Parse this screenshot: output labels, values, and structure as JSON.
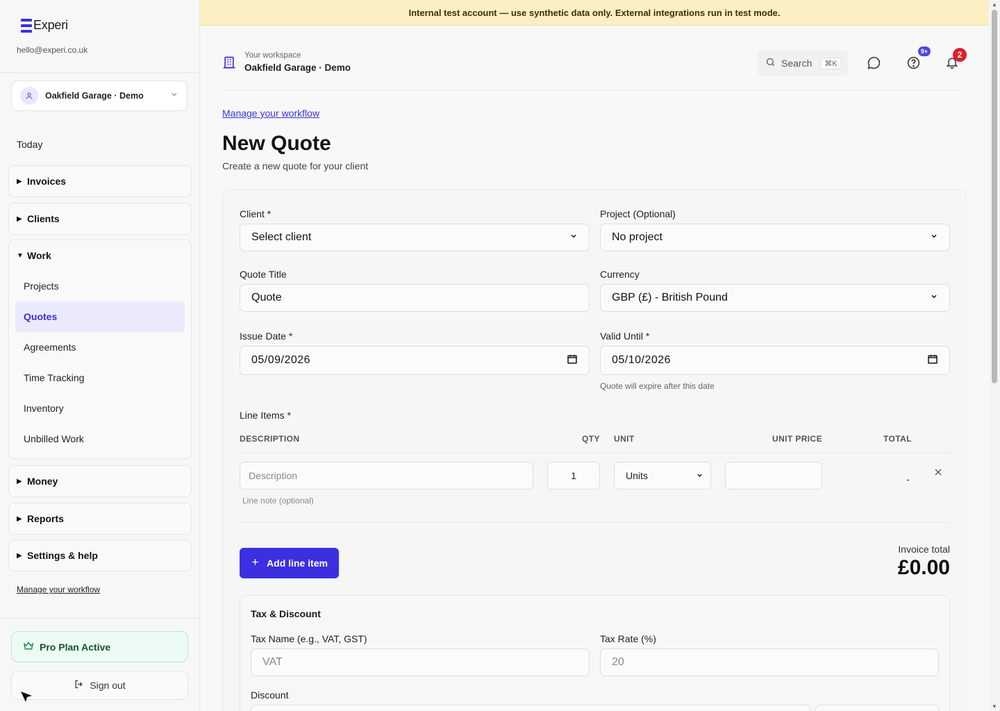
{
  "brand": {
    "name": "Experi",
    "email": "hello@experi.co.uk"
  },
  "workspace_select": {
    "value": "Oakfield Garage · Demo"
  },
  "sidebar": {
    "today": "Today",
    "groups": [
      {
        "label": "Invoices",
        "expanded": false
      },
      {
        "label": "Clients",
        "expanded": false
      },
      {
        "label": "Work",
        "expanded": true,
        "items": [
          "Projects",
          "Quotes",
          "Agreements",
          "Time Tracking",
          "Inventory",
          "Unbilled Work"
        ],
        "active": "Quotes"
      },
      {
        "label": "Money",
        "expanded": false
      },
      {
        "label": "Reports",
        "expanded": false
      },
      {
        "label": "Settings & help",
        "expanded": false
      }
    ],
    "manage_link": "Manage your workflow",
    "pro_plan": "Pro Plan Active",
    "sign_out": "Sign out"
  },
  "banner": {
    "text": "Internal test account — use synthetic data only. External integrations run in test mode."
  },
  "header": {
    "kicker": "Your workspace",
    "workspace_name": "Oakfield Garage · Demo",
    "search_label": "Search",
    "search_shortcut": "⌘K",
    "help_badge": "9+",
    "notifications_badge": "2"
  },
  "main": {
    "manage_link": "Manage your workflow",
    "title": "New Quote",
    "subtitle": "Create a new quote for your client",
    "form": {
      "client_label": "Client *",
      "client_value": "Select client",
      "project_label": "Project (Optional)",
      "project_value": "No project",
      "quote_title_label": "Quote Title",
      "quote_title_value": "Quote",
      "currency_label": "Currency",
      "currency_value": "GBP (£) - British Pound",
      "issue_date_label": "Issue Date *",
      "issue_date_value": "05/09/2026",
      "valid_until_label": "Valid Until *",
      "valid_until_value": "05/10/2026",
      "valid_until_hint": "Quote will expire after this date"
    },
    "line_items": {
      "label": "Line Items *",
      "columns": [
        "DESCRIPTION",
        "QTY",
        "UNIT",
        "UNIT PRICE",
        "TOTAL"
      ],
      "row": {
        "description_placeholder": "Description",
        "qty": "1",
        "unit": "Units",
        "unit_price": "",
        "total": "-",
        "note_placeholder": "Line note (optional)"
      },
      "add_button": "Add line item"
    },
    "invoice_total_label": "Invoice total",
    "invoice_total_value": "£0.00",
    "tax": {
      "heading": "Tax & Discount",
      "tax_name_label": "Tax Name (e.g., VAT, GST)",
      "tax_name_placeholder": "VAT",
      "tax_rate_label": "Tax Rate (%)",
      "tax_rate_placeholder": "20",
      "discount_label": "Discount"
    }
  },
  "colors": {
    "accent": "#3b2fe0",
    "banner": "#fbefc4",
    "pro": "#ecfbf3",
    "badge_red": "#e11d2e"
  }
}
